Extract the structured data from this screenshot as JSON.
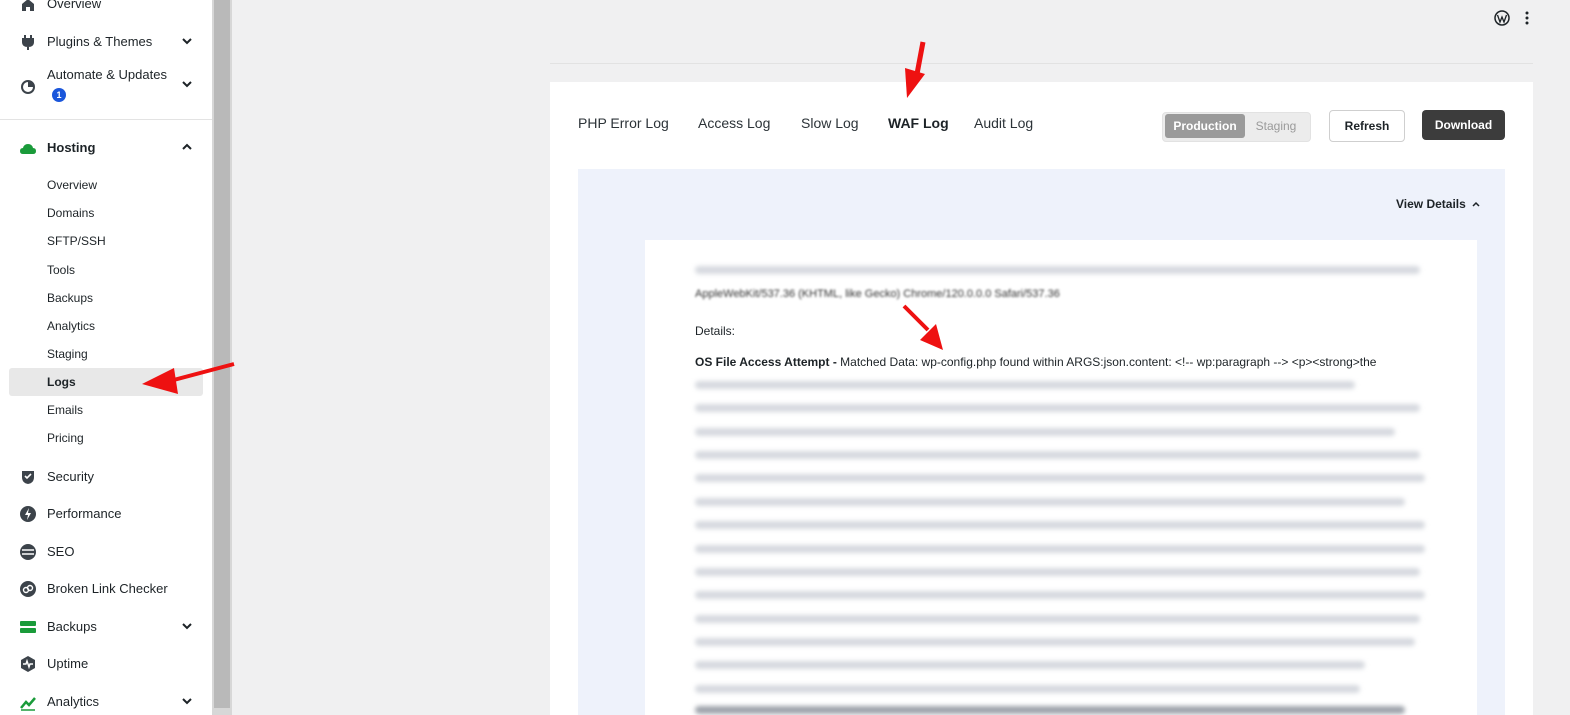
{
  "sidebar": {
    "items": [
      {
        "label": "Overview",
        "icon": "home-icon"
      },
      {
        "label": "Plugins & Themes",
        "icon": "plug-icon",
        "expandable": true
      },
      {
        "label": "Automate & Updates",
        "icon": "automate-icon",
        "badge": "1",
        "expandable": true
      },
      {
        "label": "Hosting",
        "icon": "cloud-icon",
        "expanded": true
      },
      {
        "label": "Security",
        "icon": "shield-icon"
      },
      {
        "label": "Performance",
        "icon": "bolt-icon"
      },
      {
        "label": "SEO",
        "icon": "seo-icon"
      },
      {
        "label": "Broken Link Checker",
        "icon": "broken-link-icon"
      },
      {
        "label": "Backups",
        "icon": "backups-icon",
        "expandable": true
      },
      {
        "label": "Uptime",
        "icon": "uptime-icon"
      },
      {
        "label": "Analytics",
        "icon": "analytics-icon",
        "expandable": true
      }
    ],
    "hosting_sub": [
      "Overview",
      "Domains",
      "SFTP/SSH",
      "Tools",
      "Backups",
      "Analytics",
      "Staging",
      "Logs",
      "Emails",
      "Pricing"
    ],
    "active_sub": "Logs",
    "hosting_color": "#1a9b3a"
  },
  "tabs": [
    "PHP Error Log",
    "Access Log",
    "Slow Log",
    "WAF Log",
    "Audit Log"
  ],
  "active_tab": "WAF Log",
  "env": {
    "production": "Production",
    "staging": "Staging"
  },
  "buttons": {
    "refresh": "Refresh",
    "download": "Download"
  },
  "log": {
    "view_details": "View Details",
    "partial_text": "AppleWebKit/537.36 (KHTML, like Gecko) Chrome/120.0.0.0 Safari/537.36",
    "details_label": "Details:",
    "attack_type": "OS File Access Attempt -",
    "matched_text": " Matched Data: wp-config.php found within ARGS:json.content: <!-- wp:paragraph --> <p><strong>the"
  }
}
